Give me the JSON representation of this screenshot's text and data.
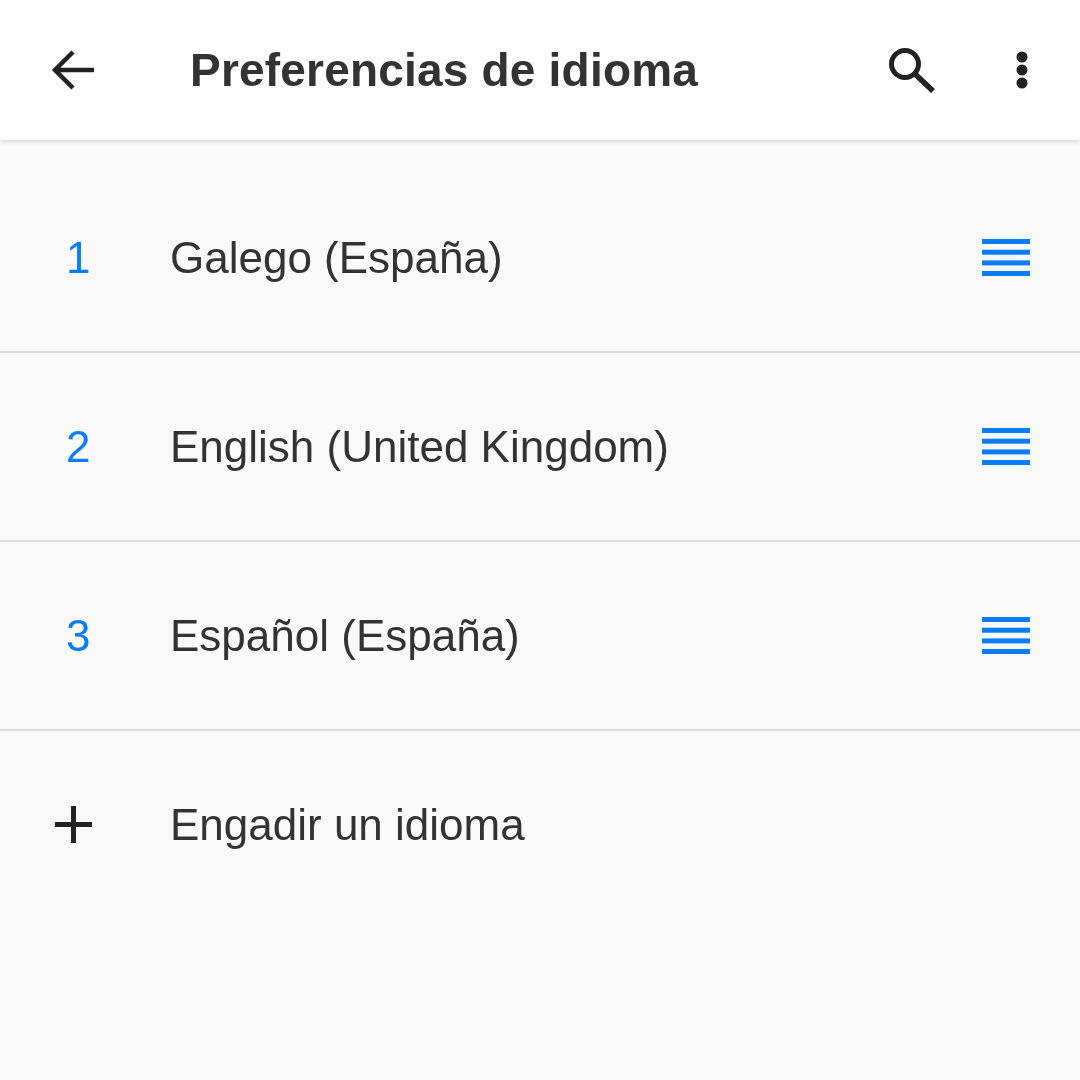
{
  "toolbar": {
    "title": "Preferencias de idioma"
  },
  "languages": [
    {
      "number": "1",
      "name": "Galego (España)"
    },
    {
      "number": "2",
      "name": "English (United Kingdom)"
    },
    {
      "number": "3",
      "name": "Español (España)"
    }
  ],
  "add_language": {
    "label": "Engadir un idioma"
  }
}
